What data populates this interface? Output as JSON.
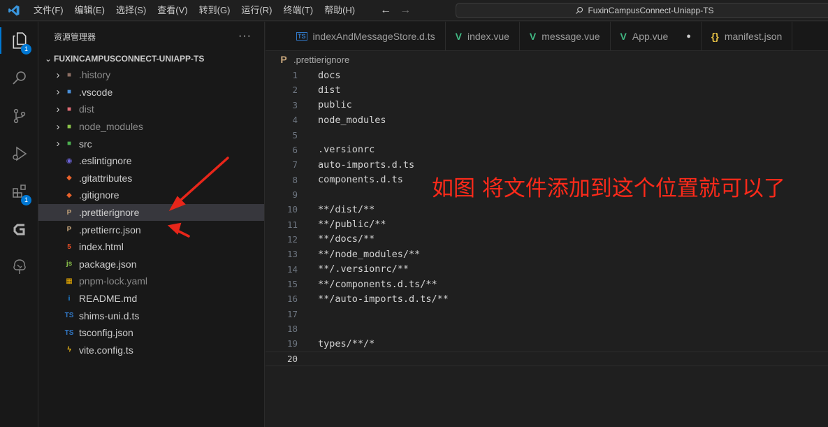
{
  "menu": [
    "文件(F)",
    "编辑(E)",
    "选择(S)",
    "查看(V)",
    "转到(G)",
    "运行(R)",
    "终端(T)",
    "帮助(H)"
  ],
  "search": {
    "text": "FuxinCampusConnect-Uniapp-TS"
  },
  "activity_bar": {
    "explorer_badge": "1",
    "extensions_badge": "1"
  },
  "sidebar": {
    "title": "资源管理器",
    "more": "···",
    "root": "FUXINCAMPUSCONNECT-UNIAPP-TS",
    "items": [
      {
        "label": ".history",
        "type": "folder"
      },
      {
        "label": ".vscode",
        "type": "folder"
      },
      {
        "label": "dist",
        "type": "folder"
      },
      {
        "label": "node_modules",
        "type": "folder"
      },
      {
        "label": "src",
        "type": "folder"
      },
      {
        "label": ".eslintignore",
        "type": "file"
      },
      {
        "label": ".gitattributes",
        "type": "file"
      },
      {
        "label": ".gitignore",
        "type": "file"
      },
      {
        "label": ".prettierignore",
        "type": "file",
        "selected": true
      },
      {
        "label": ".prettierrc.json",
        "type": "file"
      },
      {
        "label": "index.html",
        "type": "file"
      },
      {
        "label": "package.json",
        "type": "file"
      },
      {
        "label": "pnpm-lock.yaml",
        "type": "file"
      },
      {
        "label": "README.md",
        "type": "file"
      },
      {
        "label": "shims-uni.d.ts",
        "type": "file"
      },
      {
        "label": "tsconfig.json",
        "type": "file"
      },
      {
        "label": "vite.config.ts",
        "type": "file"
      }
    ]
  },
  "tabs": [
    {
      "label": "indexAndMessageStore.d.ts",
      "icon": "TS"
    },
    {
      "label": "index.vue",
      "icon": "V"
    },
    {
      "label": "message.vue",
      "icon": "V"
    },
    {
      "label": "App.vue",
      "icon": "V",
      "modified": "●"
    },
    {
      "label": "manifest.json",
      "icon": "{}"
    }
  ],
  "breadcrumb": ".prettierignore",
  "editor": {
    "current_line": 20,
    "lines": [
      {
        "n": "1",
        "text": "docs"
      },
      {
        "n": "2",
        "text": "dist"
      },
      {
        "n": "3",
        "text": "public"
      },
      {
        "n": "4",
        "text": "node_modules"
      },
      {
        "n": "5",
        "text": ""
      },
      {
        "n": "6",
        "text": ".versionrc"
      },
      {
        "n": "7",
        "text": "auto-imports.d.ts"
      },
      {
        "n": "8",
        "text": "components.d.ts"
      },
      {
        "n": "9",
        "text": ""
      },
      {
        "n": "10",
        "text": "**/dist/**"
      },
      {
        "n": "11",
        "text": "**/public/**"
      },
      {
        "n": "12",
        "text": "**/docs/**"
      },
      {
        "n": "13",
        "text": "**/node_modules/**"
      },
      {
        "n": "14",
        "text": "**/.versionrc/**"
      },
      {
        "n": "15",
        "text": "**/components.d.ts/**"
      },
      {
        "n": "16",
        "text": "**/auto-imports.d.ts/**"
      },
      {
        "n": "17",
        "text": ""
      },
      {
        "n": "18",
        "text": ""
      },
      {
        "n": "19",
        "text": "types/**/*"
      },
      {
        "n": "20",
        "text": ""
      }
    ]
  },
  "annotation": "如图 将文件添加到这个位置就可以了",
  "colors": {
    "accent": "#0078d4",
    "annotation": "#ff2a1a",
    "vue": "#41b883",
    "ts": "#3178c6"
  }
}
